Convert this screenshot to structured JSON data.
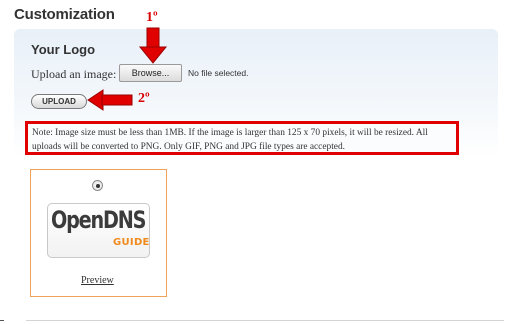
{
  "section": {
    "title": "Customization"
  },
  "logo_panel": {
    "title": "Your Logo",
    "upload_label": "Upload an image:",
    "browse_label": "Browse...",
    "file_status": "No file selected.",
    "upload_button": "UPLOAD",
    "note": "Note: Image size must be less than 1MB. If the image is larger than 125 x 70 pixels, it will be resized. All uploads will be converted to PNG. Only GIF, PNG and JPG file types are accepted."
  },
  "annotations": {
    "step1": "1º",
    "step2": "2º",
    "color": "#d80000"
  },
  "logo_option": {
    "selected": true,
    "logo_text_main": "OpenDNS",
    "logo_text_sub": "GUIDE",
    "preview_link": "Preview"
  }
}
